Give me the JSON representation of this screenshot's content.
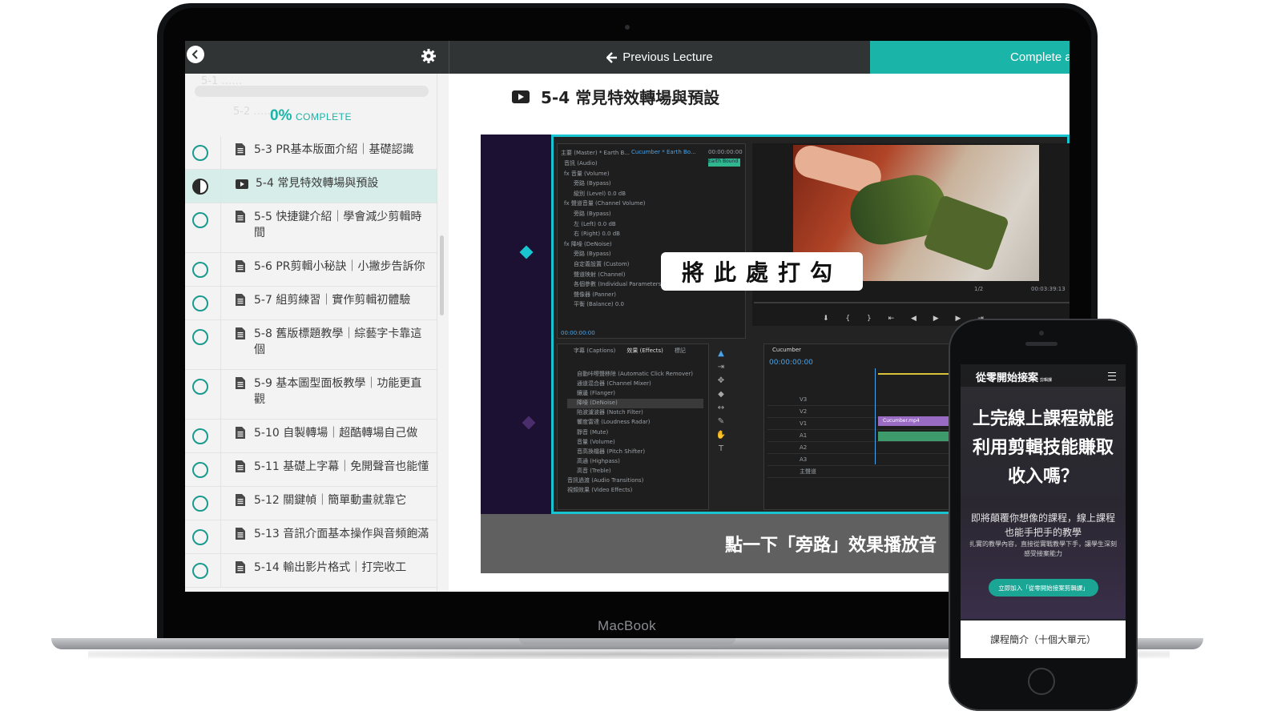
{
  "topbar": {
    "prev_label": "Previous Lecture",
    "complete_label": "Complete and Continue"
  },
  "sidebar": {
    "progress_percent": "0%",
    "progress_text": "COMPLETE",
    "progress_fraction": 0,
    "faded_rows": [
      "5-1 ……",
      "5-2 ……"
    ],
    "lessons": [
      {
        "title": "5-3 PR基本版面介紹｜基礎認識",
        "icon": "document-icon",
        "status": "not-started"
      },
      {
        "title": "5-4 常見特效轉場與預設",
        "icon": "video-icon",
        "status": "in-progress"
      },
      {
        "title": "5-5 快捷鍵介紹｜學會減少剪輯時間",
        "icon": "document-icon",
        "status": "not-started"
      },
      {
        "title": "5-6 PR剪輯小秘訣｜小撇步告訴你",
        "icon": "document-icon",
        "status": "not-started"
      },
      {
        "title": "5-7 組剪練習｜實作剪輯初體驗",
        "icon": "document-icon",
        "status": "not-started"
      },
      {
        "title": "5-8 舊版標題教學｜綜藝字卡靠這個",
        "icon": "document-icon",
        "status": "not-started"
      },
      {
        "title": "5-9 基本圖型面板教學｜功能更直觀",
        "icon": "document-icon",
        "status": "not-started"
      },
      {
        "title": "5-10 自製轉場｜超酷轉場自己做",
        "icon": "document-icon",
        "status": "not-started"
      },
      {
        "title": "5-11 基礎上字幕｜免開聲音也能懂",
        "icon": "document-icon",
        "status": "not-started"
      },
      {
        "title": "5-12 關鍵幀｜簡單動畫就靠它",
        "icon": "document-icon",
        "status": "not-started"
      },
      {
        "title": "5-13 音訊介面基本操作與音頻飽滿",
        "icon": "document-icon",
        "status": "not-started"
      },
      {
        "title": "5-14 輸出影片格式｜打完收工",
        "icon": "document-icon",
        "status": "not-started"
      }
    ]
  },
  "main": {
    "lecture_title": "5-4 常見特效轉場與預設",
    "video": {
      "callout": "將此處打勾",
      "caption": "點一下「旁路」效果播放音",
      "pr_tab_left": "主要 (Master) * Earth B...",
      "pr_tab_right": "Cucumber * Earth Bo...",
      "pr_timecode": "00:00:00:00",
      "pr_timecode2": "00:03:39:13",
      "pr_fraction": "1/2",
      "pr_tag": "Earth Bound",
      "pr_effect_rows": [
        "音訊 (Audio)",
        "fx 音量 (Volume)",
        "旁路 (Bypass)",
        "級別 (Level)  0.0 dB",
        "fx 聲道音量 (Channel Volume)",
        "旁路 (Bypass)",
        "左 (Left)  0.0 dB",
        "右 (Right)  0.0 dB",
        "fx 降噪 (DeNoise)",
        "旁路 (Bypass)",
        "自定義設置 (Custom)",
        "聲道映射 (Channel)",
        "各個參數 (Individual Parameters)",
        "聲像器 (Panner)",
        "平衡 (Balance)  0.0"
      ],
      "pr_effects_tabs": [
        "字幕 (Captions)",
        "效果 (Effects)",
        "標記"
      ],
      "pr_effects_list": [
        "自動咔嚓聲移除 (Automatic Click Remover)",
        "通道混合器 (Channel Mixer)",
        "鑲邊 (Flanger)",
        "降噪 (DeNoise)",
        "陷波濾波器 (Notch Filter)",
        "響度雷達 (Loudness Radar)",
        "靜音 (Mute)",
        "音量 (Volume)",
        "音高換檔器 (Pitch Shifter)",
        "高通 (Highpass)",
        "高音 (Treble)",
        "音訊過渡 (Audio Transitions)",
        "視頻效果 (Video Effects)"
      ],
      "pr_sequence": "Cucumber",
      "pr_tracks": [
        "V3",
        "V2",
        "V1",
        "A1",
        "A2",
        "A3",
        "主聲道"
      ],
      "pr_clip": "Cucumber.mp4"
    }
  },
  "device": {
    "laptop_label": "MacBook"
  },
  "phone": {
    "logo": "從零開始接案",
    "logo_small": "剪輯課",
    "heading": "上完線上課程就能利用剪輯技能賺取收入嗎？",
    "sub": "即將顛覆你想像的課程，線上課程也能手把手的教學",
    "small": "扎實的教學內容，直接從實戰教學下手，讓學生深刻感受接案能力",
    "cta": "立即加入「從零開始接案剪輯課」",
    "bottom": "課程簡介（十個大單元）"
  }
}
